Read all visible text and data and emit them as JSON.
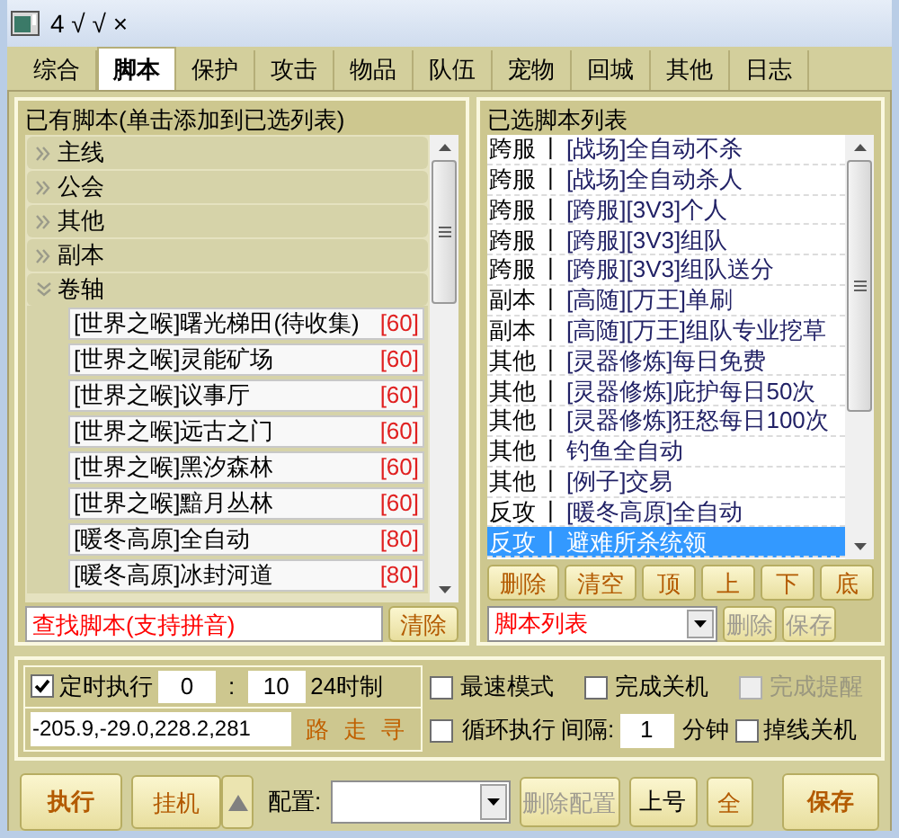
{
  "window": {
    "title": "4 √ √ ×"
  },
  "tabs": [
    {
      "label": "综合",
      "selected": false
    },
    {
      "label": "脚本",
      "selected": true
    },
    {
      "label": "保护",
      "selected": false
    },
    {
      "label": "攻击",
      "selected": false
    },
    {
      "label": "物品",
      "selected": false
    },
    {
      "label": "队伍",
      "selected": false
    },
    {
      "label": "宠物",
      "selected": false
    },
    {
      "label": "回城",
      "selected": false
    },
    {
      "label": "其他",
      "selected": false
    },
    {
      "label": "日志",
      "selected": false
    }
  ],
  "available": {
    "title": "已有脚本(单击添加到已选列表)",
    "categories": [
      {
        "label": "主线",
        "expanded": false
      },
      {
        "label": "公会",
        "expanded": false
      },
      {
        "label": "其他",
        "expanded": false
      },
      {
        "label": "副本",
        "expanded": false
      },
      {
        "label": "卷轴",
        "expanded": true,
        "children": [
          {
            "name": "[世界之喉]曙光梯田(待收集)",
            "level": "[60]"
          },
          {
            "name": "[世界之喉]灵能矿场",
            "level": "[60]"
          },
          {
            "name": "[世界之喉]议事厅",
            "level": "[60]"
          },
          {
            "name": "[世界之喉]远古之门",
            "level": "[60]"
          },
          {
            "name": "[世界之喉]黑汐森林",
            "level": "[60]"
          },
          {
            "name": "[世界之喉]黯月丛林",
            "level": "[60]"
          },
          {
            "name": "[暖冬高原]全自动",
            "level": "[80]"
          },
          {
            "name": "[暖冬高原]冰封河道",
            "level": "[80]"
          }
        ]
      }
    ],
    "search": {
      "placeholder": "查找脚本(支持拼音)"
    },
    "clear_button": "清除"
  },
  "selected_list": {
    "title": "已选脚本列表",
    "rows": [
      {
        "category": "跨服",
        "separator": "丨",
        "name": "[战场]全自动不杀",
        "selected": false
      },
      {
        "category": "跨服",
        "separator": "丨",
        "name": "[战场]全自动杀人",
        "selected": false
      },
      {
        "category": "跨服",
        "separator": "丨",
        "name": "[跨服][3V3]个人",
        "selected": false
      },
      {
        "category": "跨服",
        "separator": "丨",
        "name": "[跨服][3V3]组队",
        "selected": false
      },
      {
        "category": "跨服",
        "separator": "丨",
        "name": "[跨服][3V3]组队送分",
        "selected": false
      },
      {
        "category": "副本",
        "separator": "丨",
        "name": "[高随][万王]单刷",
        "selected": false
      },
      {
        "category": "副本",
        "separator": "丨",
        "name": "[高随][万王]组队专业挖草",
        "selected": false
      },
      {
        "category": "其他",
        "separator": "丨",
        "name": "[灵器修炼]每日免费",
        "selected": false
      },
      {
        "category": "其他",
        "separator": "丨",
        "name": "[灵器修炼]庇护每日50次",
        "selected": false
      },
      {
        "category": "其他",
        "separator": "丨",
        "name": "[灵器修炼]狂怒每日100次",
        "selected": false
      },
      {
        "category": "其他",
        "separator": "丨",
        "name": "钓鱼全自动",
        "selected": false
      },
      {
        "category": "其他",
        "separator": "丨",
        "name": "[例子]交易",
        "selected": false
      },
      {
        "category": "反攻",
        "separator": "丨",
        "name": "[暖冬高原]全自动",
        "selected": false
      },
      {
        "category": "反攻",
        "separator": "丨",
        "name": "避难所杀统领",
        "selected": true
      }
    ],
    "buttons": [
      "删除",
      "清空",
      "顶",
      "上",
      "下",
      "底"
    ],
    "list_select": "脚本列表",
    "list_buttons": [
      {
        "label": "删除",
        "disabled": true
      },
      {
        "label": "保存",
        "disabled": true
      }
    ]
  },
  "schedule": {
    "label": "定时执行",
    "checked": true,
    "hour": "0",
    "colon": ":",
    "minute": "10",
    "format": "24时制"
  },
  "coords": {
    "value": "-205.9,-29.0,228.2,281",
    "actions": [
      "路",
      "走",
      "寻"
    ]
  },
  "options": [
    {
      "label": "最速模式",
      "checked": false,
      "disabled": false
    },
    {
      "label": "完成关机",
      "checked": false,
      "disabled": false
    },
    {
      "label": "完成提醒",
      "checked": false,
      "disabled": true
    }
  ],
  "loop": {
    "label": "循环执行",
    "checked": false,
    "interval_label": "间隔:",
    "interval": "1",
    "unit": "分钟"
  },
  "disconnect": {
    "label": "掉线关机",
    "checked": false
  },
  "bottom": {
    "run": "执行",
    "idle": "挂机",
    "config_label": "配置:",
    "delete_config": {
      "label": "删除配置",
      "disabled": true
    },
    "login": "上号",
    "all": "全",
    "save": "保存"
  }
}
